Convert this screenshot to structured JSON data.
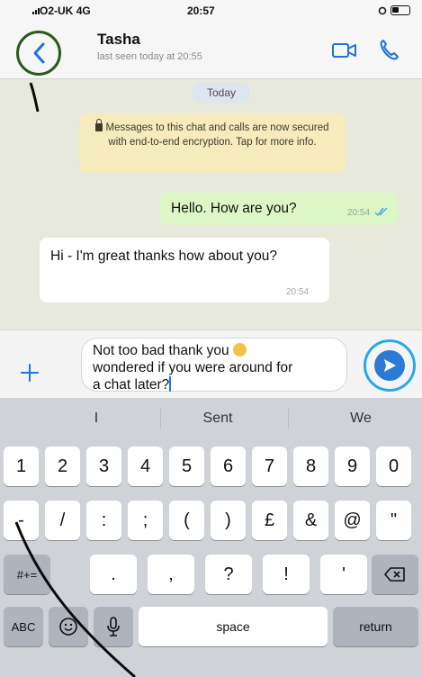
{
  "status_bar": {
    "carrier": "O2-UK",
    "network": "4G",
    "time": "20:57"
  },
  "header": {
    "contact_name": "Tasha",
    "last_seen": "last seen today at 20:55"
  },
  "chat": {
    "date_label": "Today",
    "encryption_notice": "Messages to this chat and calls are now secured with end-to-end encryption. Tap for more info.",
    "messages": [
      {
        "direction": "outgoing",
        "text": "Hello. How are you?",
        "time": "20:54"
      },
      {
        "direction": "incoming",
        "text": "Hi - I'm great thanks how about you?",
        "time": "20:54"
      }
    ]
  },
  "compose": {
    "line1": "Not too bad thank you",
    "line2": "wondered if you were around for",
    "line3": "a chat later?"
  },
  "keyboard": {
    "suggestions": [
      "I",
      "Sent",
      "We"
    ],
    "row1": [
      "1",
      "2",
      "3",
      "4",
      "5",
      "6",
      "7",
      "8",
      "9",
      "0"
    ],
    "row2": [
      "-",
      "/",
      ":",
      ";",
      "(",
      ")",
      "£",
      "&",
      "@",
      "\""
    ],
    "row3_left": "#+=",
    "row3": [
      ".",
      ",",
      "?",
      "!",
      "'"
    ],
    "abc": "ABC",
    "space": "space",
    "return": "return"
  },
  "colors": {
    "outgoing_bubble": "#dcf7c5",
    "incoming_bubble": "#ffffff",
    "notice": "#f5ebbd",
    "send": "#2a7ad6",
    "annotation_back": "#2b5a1c",
    "annotation_send": "#29a9ec"
  }
}
